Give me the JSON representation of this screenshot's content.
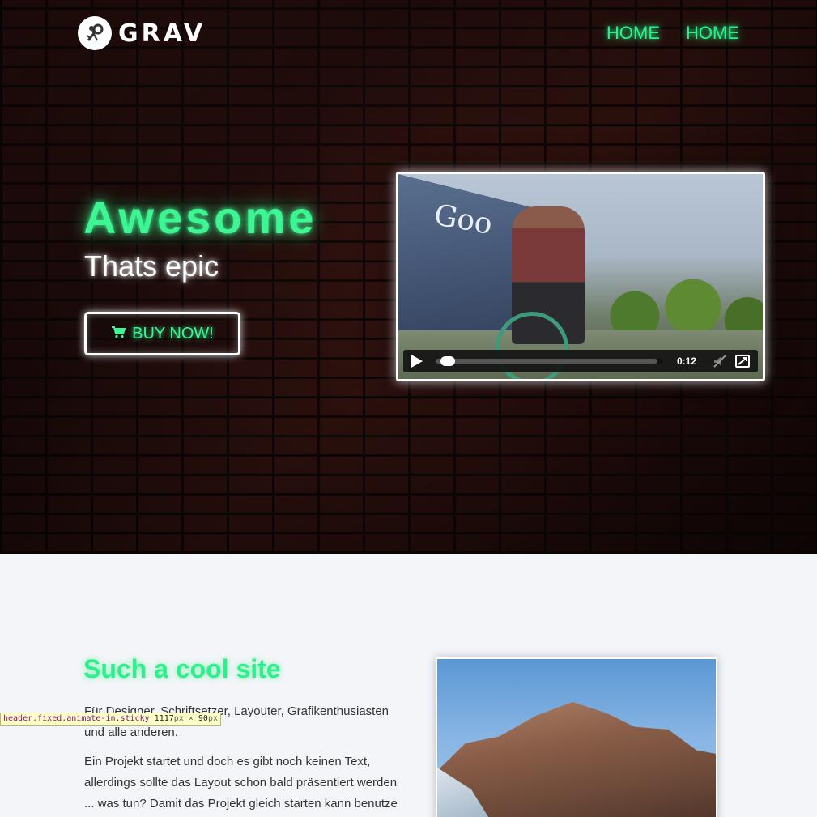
{
  "header": {
    "logo_text": "GRAV",
    "nav": [
      {
        "label": "HOME"
      },
      {
        "label": "HOME"
      }
    ]
  },
  "hero": {
    "headline": "Awesome",
    "subheadline": "Thats epic",
    "buy_button_label": "BUY NOW!",
    "accent_color": "#3df593"
  },
  "video": {
    "sign_text": "Goo",
    "time": "0:12",
    "progress": 0.02
  },
  "section": {
    "title": "Such a cool site",
    "paragraph1": "Für Designer, Schriftsetzer, Layouter, Grafikenthusiasten und alle anderen.",
    "paragraph2": "Ein Projekt startet und doch es gibt noch keinen Text, allerdings sollte das Layout schon bald präsentiert werden ... was tun? Damit das Projekt gleich starten kann benutze"
  },
  "devtools": {
    "selector": "header.fixed.animate-in.sticky",
    "width": "1117",
    "height": "90",
    "unit": "px",
    "times": "×"
  }
}
